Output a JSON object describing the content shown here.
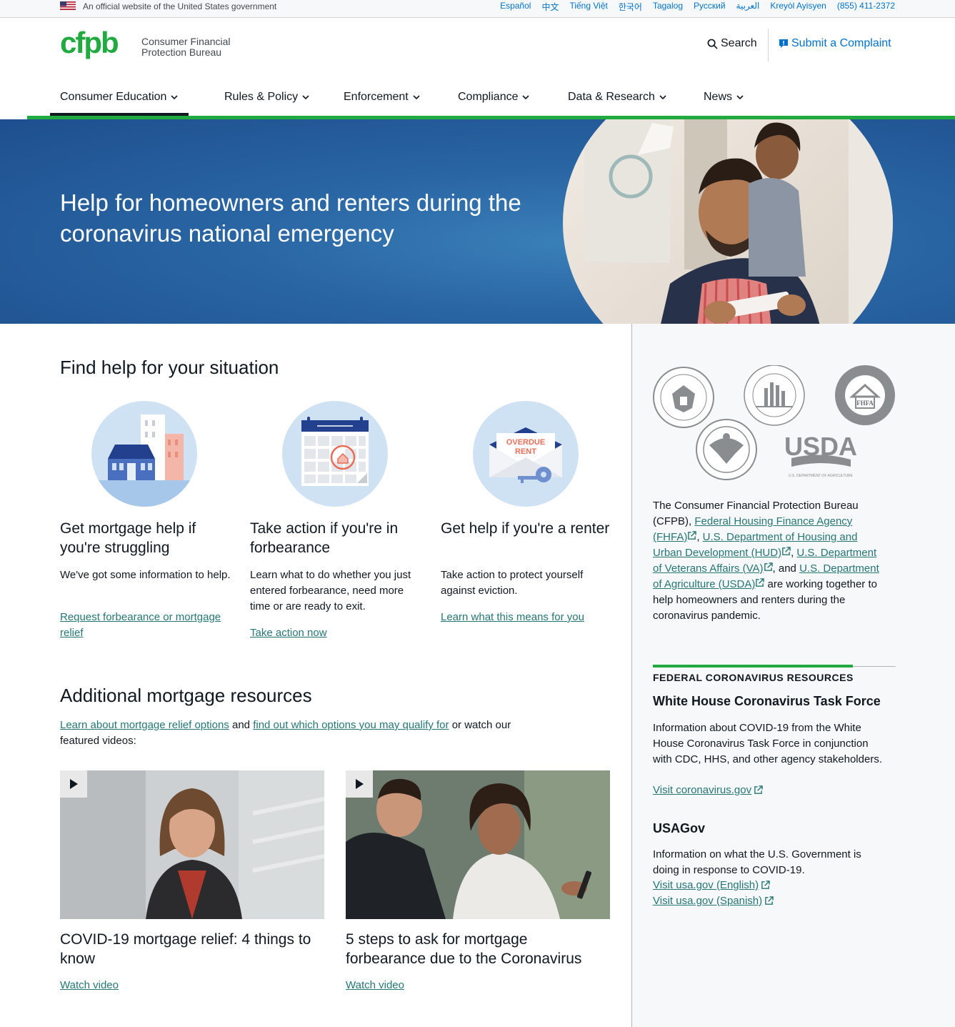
{
  "gov_banner": {
    "text": "An official website of the United States government",
    "languages": [
      "Español",
      "中文",
      "Tiếng Việt",
      "한국어",
      "Tagalog",
      "Pусский",
      "العربية",
      "Kreyòl Ayisyen",
      "(855) 411-2372"
    ]
  },
  "header": {
    "logo_mark": "cfpb",
    "logo_line1": "Consumer Financial",
    "logo_line2": "Protection Bureau",
    "search_label": "Search",
    "complaint_label": "Submit a Complaint"
  },
  "nav": {
    "items": [
      {
        "label": "Consumer Education"
      },
      {
        "label": "Rules & Policy"
      },
      {
        "label": "Enforcement"
      },
      {
        "label": "Compliance"
      },
      {
        "label": "Data & Research"
      },
      {
        "label": "News"
      }
    ],
    "active": "Consumer Education"
  },
  "hero": {
    "heading": "Help for homeowners and renters during the coronavirus national emergency"
  },
  "find_help": {
    "heading": "Find help for your situation",
    "cards": [
      {
        "icon": "houses-icon",
        "title": "Get mortgage help if you're struggling",
        "desc": "We've got some information to help.",
        "link": "Request forbearance or mortgage relief"
      },
      {
        "icon": "calendar-icon",
        "title": "Take action if you're in forbearance",
        "desc": "Learn what to do whether you just entered forbearance, need more time or are ready to exit.",
        "link": "Take action now"
      },
      {
        "icon": "overdue-rent-envelope-icon",
        "icon_text_1": "OVERDUE",
        "icon_text_2": "RENT",
        "title": "Get help if you're a renter",
        "desc": "Take action to protect yourself against eviction.",
        "link": "Learn what this means for you"
      }
    ]
  },
  "additional": {
    "heading": "Additional mortgage resources",
    "link1": "Learn about mortgage relief options",
    "middle": " and ",
    "link2": "find out which options you may qualify for",
    "tail": " or watch our featured videos:",
    "videos": [
      {
        "title": "COVID-19 mortgage relief: 4 things to know",
        "link": "Watch video"
      },
      {
        "title": "5 steps to ask for mortgage forbearance due to the Coronavirus",
        "link": "Watch video"
      }
    ]
  },
  "sidebar": {
    "seal_text": "USDA",
    "seal_caption": "U.S. DEPARTMENT OF AGRICULTURE",
    "fhfa_text": "FHFA",
    "blurb_pre": "The Consumer Financial Protection Bureau (CFPB), ",
    "blurb_link1": "Federal Housing Finance Agency (FHFA)",
    "blurb_sep1": ", ",
    "blurb_link2": "U.S. Department of Housing and Urban Development (HUD)",
    "blurb_sep2": ", ",
    "blurb_link3": "U.S. Department of Veterans Affairs (VA)",
    "blurb_sep3": ", and ",
    "blurb_link4": "U.S. Department of Agriculture (USDA)",
    "blurb_post": " are working together to help homeowners and renters during the coronavirus pandemic.",
    "resources_header": "FEDERAL CORONAVIRUS RESOURCES",
    "res1_title": "White House Coronavirus Task Force",
    "res1_desc": "Information about COVID-19 from the White House Coronavirus Task Force in conjunction with CDC, HHS, and other agency stakeholders.",
    "res1_link": "Visit coronavirus.gov",
    "res2_title": "USAGov",
    "res2_desc": "Information on what the U.S. Government is doing in response to COVID-19.",
    "res2_link1": "Visit usa.gov (English)",
    "res2_link2": "Visit usa.gov (Spanish)"
  },
  "colors": {
    "brand_green": "#20aa3f",
    "link_blue": "#0072ce",
    "link_teal": "#257675",
    "hero_blue": "#2a66a4",
    "sidebar_bg": "#f7f8f9"
  }
}
